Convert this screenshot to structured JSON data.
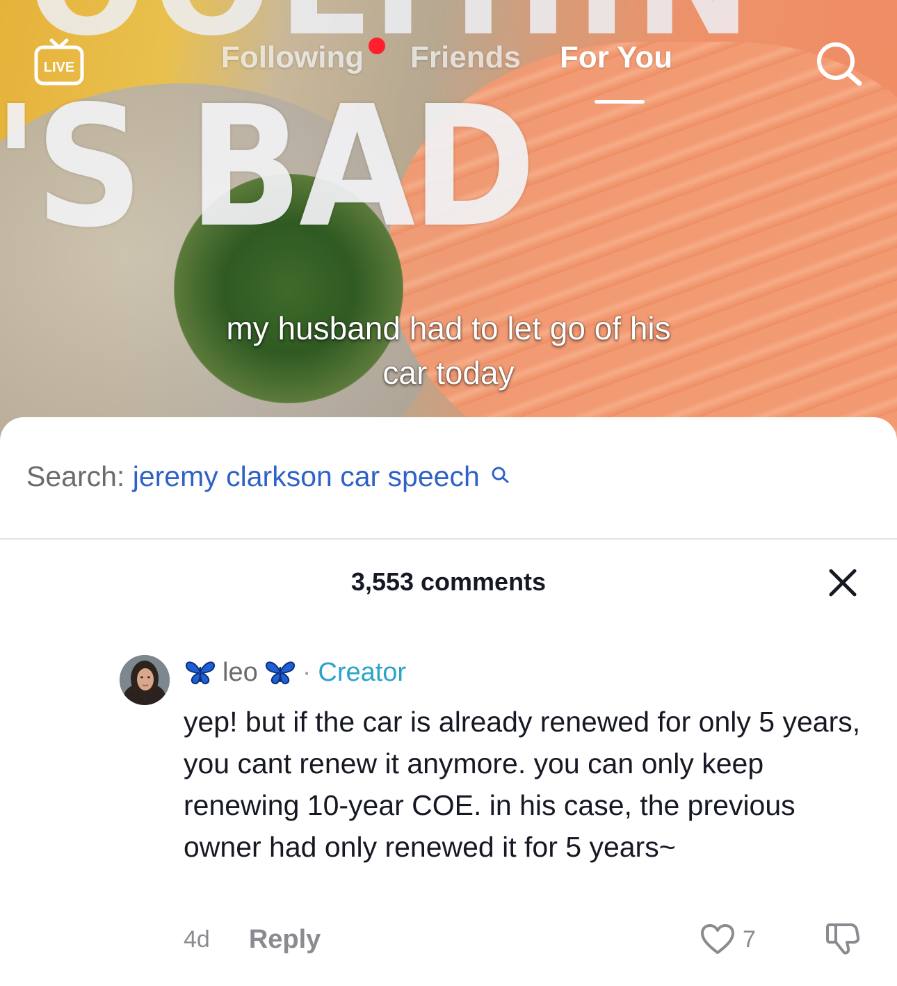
{
  "video": {
    "overlay_top_text": "OOLTHIN",
    "overlay_big_text": "'S BAD",
    "caption": "my husband had to let go of his car today"
  },
  "topnav": {
    "live_label": "LIVE",
    "tabs": [
      {
        "label": "Following",
        "has_notification": true
      },
      {
        "label": "Friends"
      },
      {
        "label": "For You",
        "active": true
      }
    ]
  },
  "search_suggestion": {
    "prefix": "Search:",
    "query": "jeremy clarkson car speech"
  },
  "comments": {
    "count_label": "3,553 comments",
    "items": [
      {
        "author": "leo",
        "badge": "Creator",
        "text": "yep! but if the car is already renewed for only 5 years, you cant renew it anymore. you can only keep renewing 10-year COE. in his case, the previous owner had only renewed it for 5 years~",
        "time": "4d",
        "reply_label": "Reply",
        "likes": "7"
      }
    ]
  },
  "colors": {
    "accent_blue": "#2f62c8",
    "creator_teal": "#2aa3c8",
    "notification_red": "#ff1f2d",
    "butterfly_blue": "#1f5fd6"
  }
}
